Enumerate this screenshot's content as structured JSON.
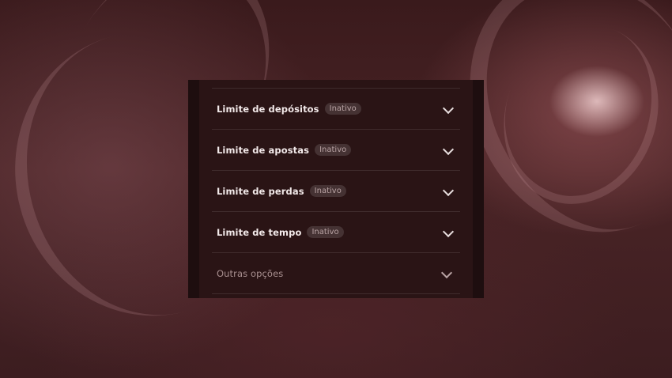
{
  "limits": [
    {
      "label": "Limite de depósitos",
      "status": "Inativo"
    },
    {
      "label": "Limite de apostas",
      "status": "Inativo"
    },
    {
      "label": "Limite de perdas",
      "status": "Inativo"
    },
    {
      "label": "Limite de tempo",
      "status": "Inativo"
    }
  ],
  "other_options": {
    "label": "Outras opções"
  },
  "icons": {
    "expand": "chevron-down-icon"
  },
  "colors": {
    "background": "#3a1a1c",
    "panel": "#2a1415",
    "text": "#f3eaea",
    "muted": "#a99090"
  }
}
